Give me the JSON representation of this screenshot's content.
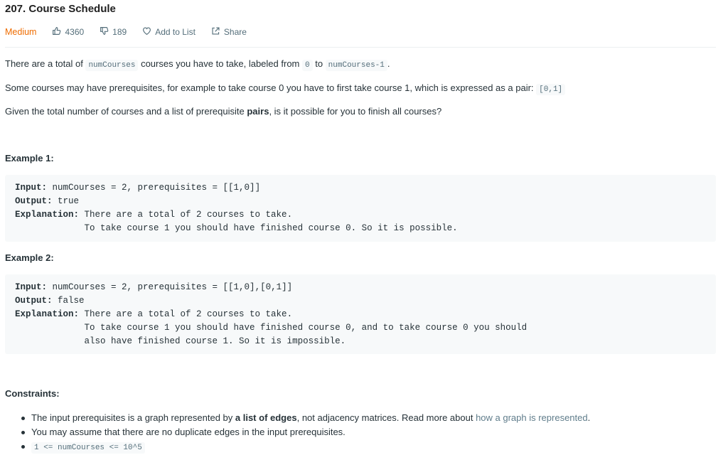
{
  "problem": {
    "title": "207. Course Schedule",
    "difficulty": "Medium",
    "likes": "4360",
    "dislikes": "189",
    "add_to_list": "Add to List",
    "share": "Share"
  },
  "description": {
    "p1": {
      "t1": "There are a total of ",
      "c1": "numCourses",
      "t2": " courses you have to take, labeled from ",
      "c2": "0",
      "t3": " to ",
      "c3": "numCourses-1",
      "t4": "."
    },
    "p2": {
      "t1": "Some courses may have prerequisites, for example to take course 0 you have to first take course 1, which is expressed as a pair: ",
      "c1": "[0,1]"
    },
    "p3": {
      "t1": "Given the total number of courses and a list of prerequisite ",
      "b1": "pairs",
      "t2": ", is it possible for you to finish all courses?"
    }
  },
  "examples": [
    {
      "heading": "Example 1:",
      "input_label": "Input:",
      "input": " numCourses = 2, prerequisites = [[1,0]]",
      "output_label": "Output:",
      "output": " true",
      "explanation_label": "Explanation:",
      "explanation_lines": [
        " There are a total of 2 courses to take.",
        "             To take course 1 you should have finished course 0. So it is possible."
      ]
    },
    {
      "heading": "Example 2:",
      "input_label": "Input:",
      "input": " numCourses = 2, prerequisites = [[1,0],[0,1]]",
      "output_label": "Output:",
      "output": " false",
      "explanation_label": "Explanation:",
      "explanation_lines": [
        " There are a total of 2 courses to take.",
        "             To take course 1 you should have finished course 0, and to take course 0 you should",
        "             also have finished course 1. So it is impossible."
      ]
    }
  ],
  "constraints": {
    "heading": "Constraints:",
    "items": [
      {
        "t1": "The input prerequisites is a graph represented by ",
        "b1": "a list of edges",
        "t2": ", not adjacency matrices. Read more about ",
        "link": "how a graph is represented",
        "t3": "."
      },
      {
        "t1": "You may assume that there are no duplicate edges in the input prerequisites."
      },
      {
        "code": "1 <= numCourses <= 10^5"
      }
    ]
  },
  "icons": {
    "likes": "thumbs-up-icon",
    "dislikes": "thumbs-down-icon",
    "add_to_list": "heart-icon",
    "share": "share-icon"
  },
  "colors": {
    "difficulty_medium": "#ef6c00",
    "link": "#607d8b",
    "code_bg": "#f7f9fa"
  }
}
